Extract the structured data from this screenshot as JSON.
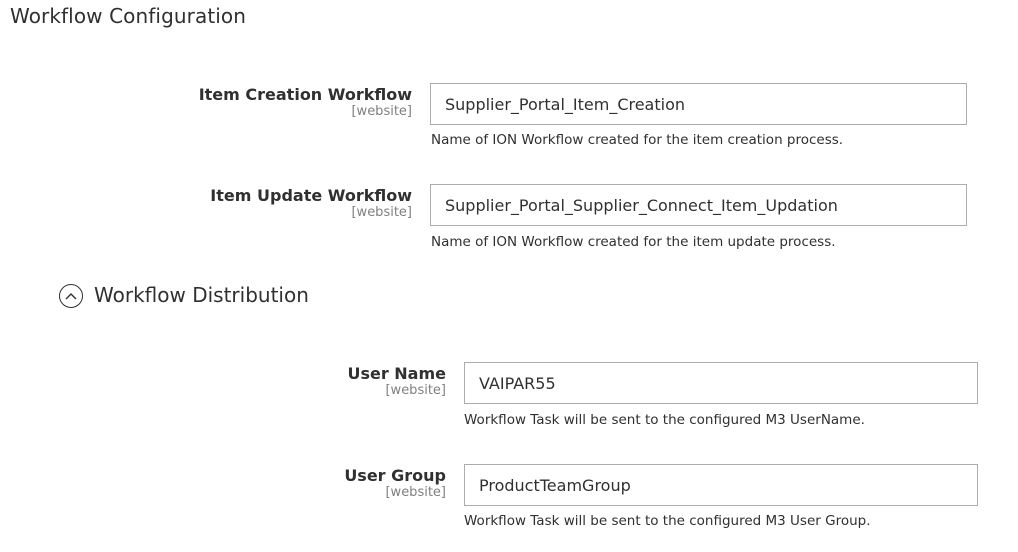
{
  "section": {
    "title": "Workflow Configuration"
  },
  "fields": {
    "item_creation": {
      "label": "Item Creation Workflow",
      "scope": "[website]",
      "value": "Supplier_Portal_Item_Creation",
      "note": "Name of ION Workflow created for the item creation process."
    },
    "item_update": {
      "label": "Item Update Workflow",
      "scope": "[website]",
      "value": "Supplier_Portal_Supplier_Connect_Item_Updation",
      "note": "Name of ION Workflow created for the item update process."
    }
  },
  "distribution": {
    "title": "Workflow Distribution",
    "toggle_icon": "chevron-up-circle-icon",
    "user_name": {
      "label": "User Name",
      "scope": "[website]",
      "value": "VAIPAR55",
      "note": "Workflow Task will be sent to the configured M3 UserName."
    },
    "user_group": {
      "label": "User Group",
      "scope": "[website]",
      "value": "ProductTeamGroup",
      "note": "Workflow Task will be sent to the configured M3 User Group."
    }
  }
}
